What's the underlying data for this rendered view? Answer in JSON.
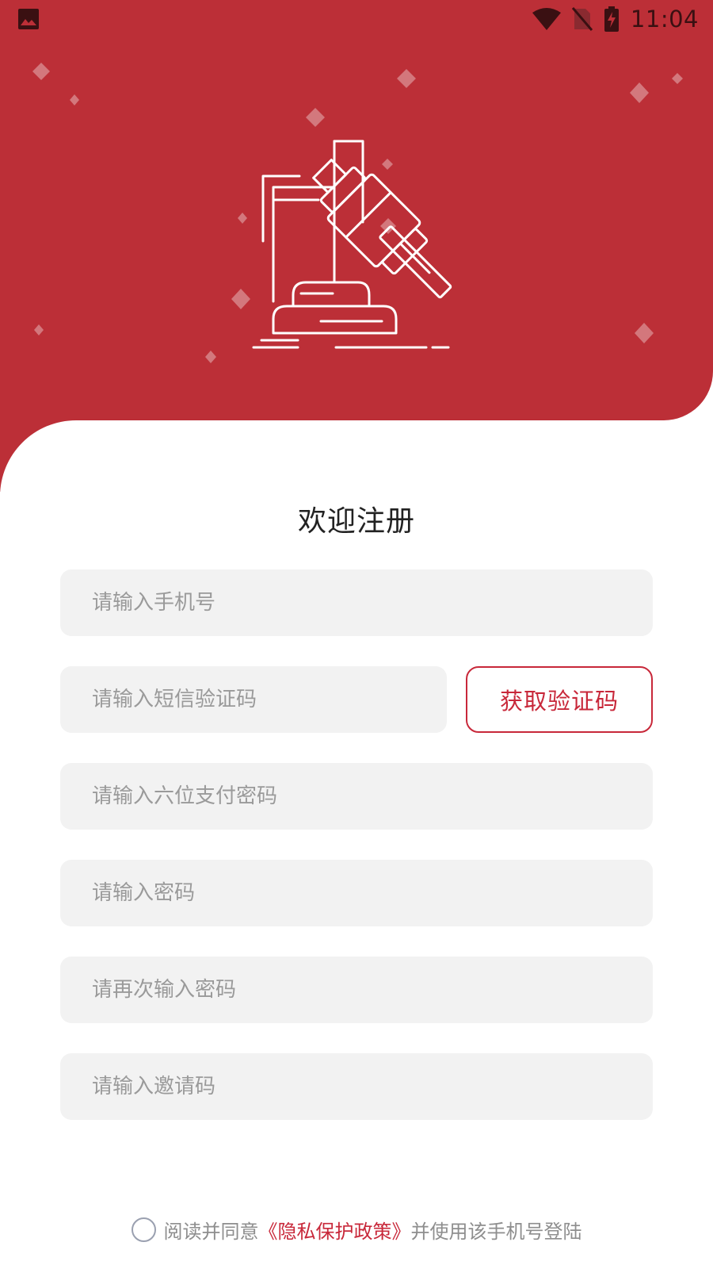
{
  "status_bar": {
    "time": "11:04",
    "icons": [
      "image-icon",
      "wifi-icon",
      "no-sim-icon",
      "battery-charging-icon"
    ]
  },
  "colors": {
    "brand_red": "#bc2f37",
    "accent_red": "#c8283a",
    "field_bg": "#f2f2f2",
    "placeholder": "#9a9a9a"
  },
  "header": {
    "illustration_icon": "gavel-icon"
  },
  "form": {
    "title": "欢迎注册",
    "phone_placeholder": "请输入手机号",
    "sms_placeholder": "请输入短信验证码",
    "get_code_label": "获取验证码",
    "pay_password_placeholder": "请输入六位支付密码",
    "password_placeholder": "请输入密码",
    "password_confirm_placeholder": "请再次输入密码",
    "invite_placeholder": "请输入邀请码"
  },
  "agreement": {
    "prefix": "阅读并同意",
    "policy_link": "《隐私保护政策》",
    "suffix": "并使用该手机号登陆",
    "checked": false
  }
}
